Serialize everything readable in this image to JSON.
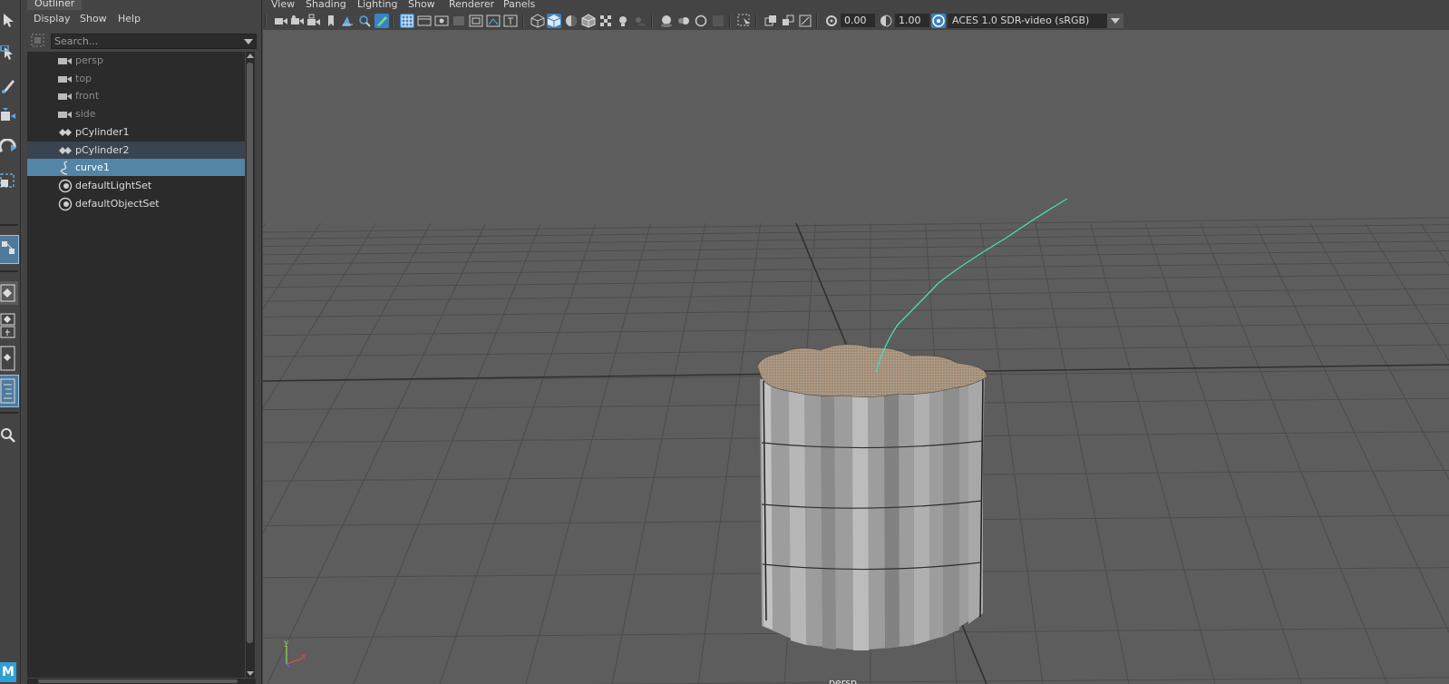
{
  "outliner": {
    "tab_label": "Outliner",
    "menu": [
      "Display",
      "Show",
      "Help"
    ],
    "search": {
      "placeholder": "Search...",
      "value": ""
    },
    "items": [
      {
        "label": "persp",
        "icon": "camera-icon",
        "dimmed": true,
        "state": "normal"
      },
      {
        "label": "top",
        "icon": "camera-icon",
        "dimmed": true,
        "state": "normal"
      },
      {
        "label": "front",
        "icon": "camera-icon",
        "dimmed": true,
        "state": "normal"
      },
      {
        "label": "side",
        "icon": "camera-icon",
        "dimmed": true,
        "state": "normal"
      },
      {
        "label": "pCylinder1",
        "icon": "mesh-transform-icon",
        "dimmed": false,
        "state": "normal"
      },
      {
        "label": "pCylinder2",
        "icon": "mesh-transform-icon",
        "dimmed": false,
        "state": "highlighted"
      },
      {
        "label": "curve1",
        "icon": "curve-icon",
        "dimmed": false,
        "state": "selected"
      },
      {
        "label": "defaultLightSet",
        "icon": "set-icon",
        "dimmed": false,
        "state": "normal"
      },
      {
        "label": "defaultObjectSet",
        "icon": "set-icon",
        "dimmed": false,
        "state": "normal"
      }
    ]
  },
  "viewport": {
    "menu": [
      "View",
      "Shading",
      "Lighting",
      "Show",
      "Renderer",
      "Panels"
    ],
    "exposure": "0.00",
    "gamma": "1.00",
    "color_space": "ACES 1.0 SDR-video (sRGB)",
    "camera_label": "persp",
    "axis": {
      "x": "x",
      "y": "y"
    }
  },
  "toolbox": {
    "logo": "M"
  },
  "colors": {
    "viewport_bg": "#5d5d5d",
    "grid": "#4a4a4a",
    "selection": "#5285a6",
    "curve": "#45e0b4",
    "cylinder": "#a0a0a0"
  }
}
